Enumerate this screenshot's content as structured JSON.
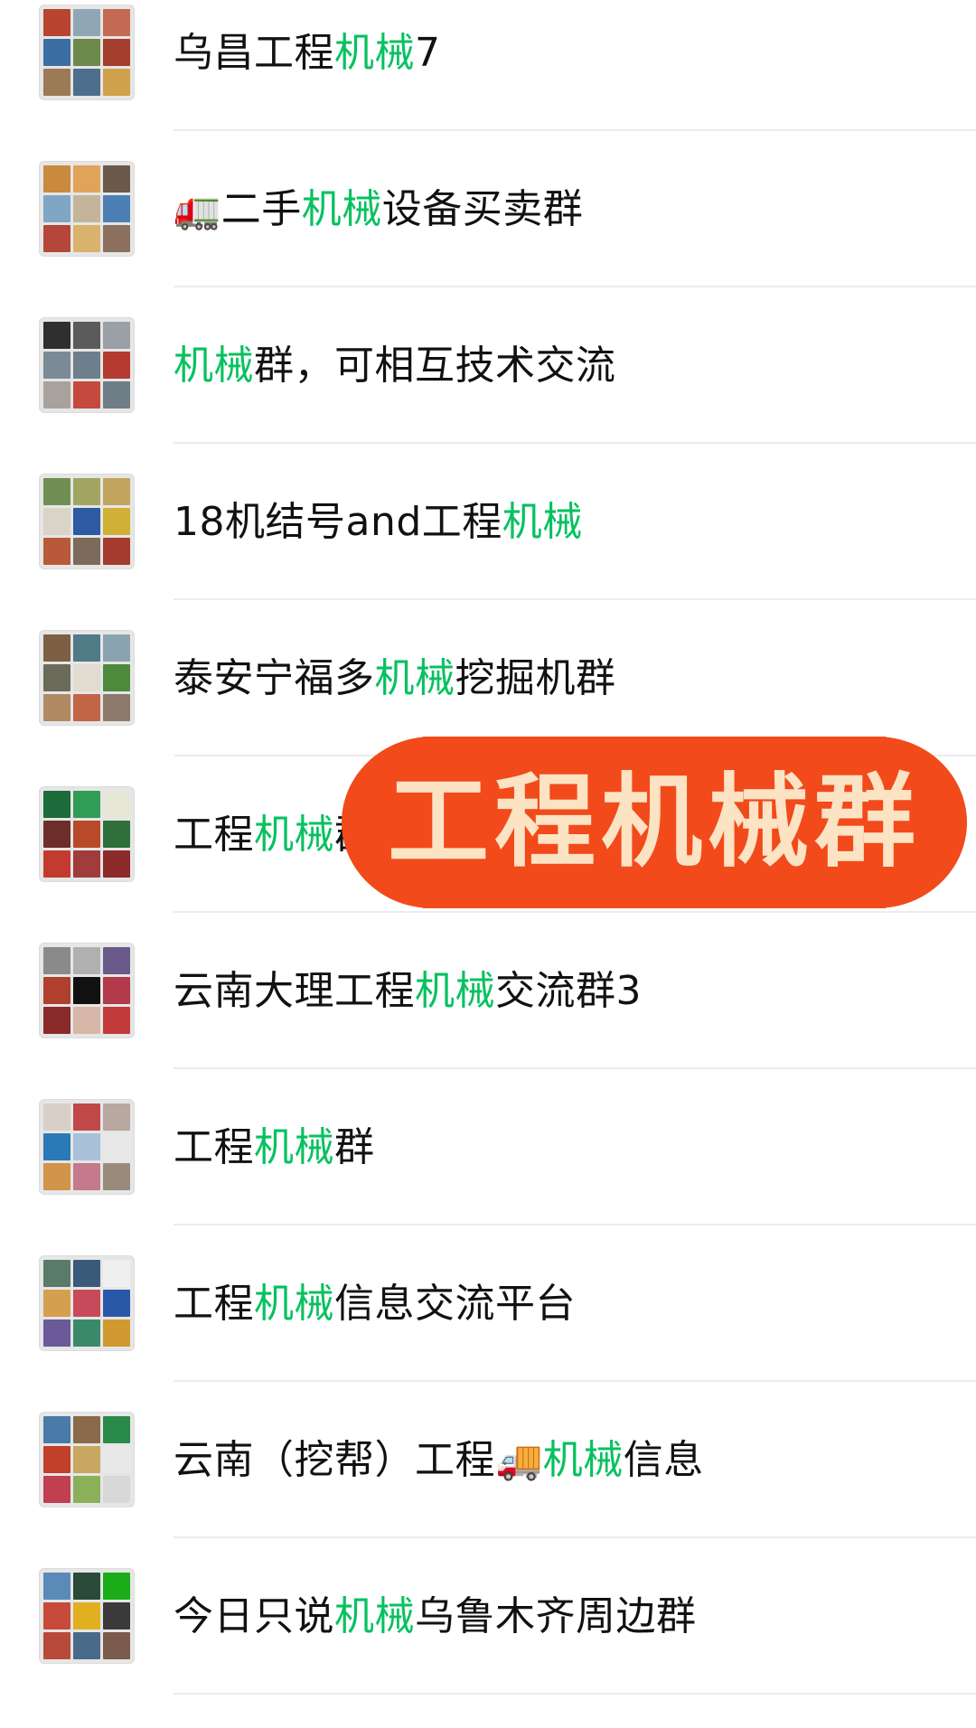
{
  "group_list": {
    "highlight_color": "#07c160",
    "items": [
      {
        "segments": [
          {
            "t": "乌昌工程"
          },
          {
            "t": "机械",
            "hl": true
          },
          {
            "t": "7"
          }
        ]
      },
      {
        "segments": [
          {
            "t": "🚛",
            "emoji": true
          },
          {
            "t": "二手"
          },
          {
            "t": "机械",
            "hl": true
          },
          {
            "t": "设备买卖群"
          }
        ]
      },
      {
        "segments": [
          {
            "t": "机械",
            "hl": true
          },
          {
            "t": "群，可相互技术交流"
          }
        ]
      },
      {
        "segments": [
          {
            "t": "18机结号and工程"
          },
          {
            "t": "机械",
            "hl": true
          }
        ]
      },
      {
        "segments": [
          {
            "t": "泰安宁福多"
          },
          {
            "t": "机械",
            "hl": true
          },
          {
            "t": "挖掘机群"
          }
        ]
      },
      {
        "segments": [
          {
            "t": "工程"
          },
          {
            "t": "机械",
            "hl": true
          },
          {
            "t": "群"
          }
        ]
      },
      {
        "segments": [
          {
            "t": "云南大理工程"
          },
          {
            "t": "机械",
            "hl": true
          },
          {
            "t": "交流群3"
          }
        ]
      },
      {
        "segments": [
          {
            "t": "工程"
          },
          {
            "t": "机械",
            "hl": true
          },
          {
            "t": "群"
          }
        ]
      },
      {
        "segments": [
          {
            "t": "工程"
          },
          {
            "t": "机械",
            "hl": true
          },
          {
            "t": "信息交流平台"
          }
        ]
      },
      {
        "segments": [
          {
            "t": "云南（挖帮）工程"
          },
          {
            "t": "🚚",
            "emoji": true
          },
          {
            "t": "机械",
            "hl": true
          },
          {
            "t": "信息"
          }
        ]
      },
      {
        "segments": [
          {
            "t": "今日只说"
          },
          {
            "t": "机械",
            "hl": true
          },
          {
            "t": "乌鲁木齐周边群"
          }
        ]
      }
    ]
  },
  "overlay_banner": {
    "text": "工程机械群",
    "bg_color": "#f24a1b",
    "text_color": "#fbe3c4"
  },
  "avatar_palettes": [
    [
      "#b8452f",
      "#8fa7b5",
      "#c46a52",
      "#3b6fa3",
      "#6c8a4a",
      "#a33d2c",
      "#9a7b55",
      "#4d6e8c",
      "#d0a24c"
    ],
    [
      "#c98a3d",
      "#e0a35a",
      "#6b5a4a",
      "#7fa6c4",
      "#c2b59b",
      "#4b7fb3",
      "#b5473a",
      "#d9b36b",
      "#8c7060"
    ],
    [
      "#2f2f2f",
      "#5b5b5b",
      "#9aa0a6",
      "#7b8a95",
      "#6d7f8c",
      "#b53a30",
      "#a7a39c",
      "#c5493c",
      "#6e7d86"
    ],
    [
      "#6f8f55",
      "#a1a562",
      "#c2a45e",
      "#d9d4c7",
      "#2d5aa0",
      "#d0b035",
      "#b85a3a",
      "#7e6a5a",
      "#a53b2f"
    ],
    [
      "#7d5f44",
      "#4f7a86",
      "#8aa3b0",
      "#6b6b5a",
      "#e1dccf",
      "#4e8a3c",
      "#b08a62",
      "#c26446",
      "#8d7a6a"
    ],
    [
      "#1d6a3a",
      "#2f9d55",
      "#e7e7d8",
      "#6b2e2a",
      "#b84a2a",
      "#2f6f3a",
      "#c23b2e",
      "#a03c3c",
      "#8c2a2a"
    ],
    [
      "#8a8a8a",
      "#b0b0b0",
      "#6a5a8a",
      "#b0402e",
      "#111111",
      "#b23a4a",
      "#8a2a2a",
      "#d7b8a8",
      "#c23a3a"
    ],
    [
      "#d8d0c8",
      "#c04848",
      "#b8a8a0",
      "#2a7ab8",
      "#a8c0d8",
      "#e8e8e8",
      "#d0944a",
      "#c47a8a",
      "#9a8a7a"
    ],
    [
      "#5a7a6a",
      "#3a5a7a",
      "#efefef",
      "#d4a050",
      "#c84a5a",
      "#2a58a8",
      "#6a5a9a",
      "#3a8a6a",
      "#d09a30"
    ],
    [
      "#4a7aa8",
      "#8a6a4a",
      "#2a8a4a",
      "#c0402a",
      "#c8a860",
      "#e8e8e8",
      "#c04050",
      "#8ab05a",
      "#d8d8d8"
    ],
    [
      "#5a8ab8",
      "#2a4a3a",
      "#1aad19",
      "#c84a3a",
      "#e0b020",
      "#3a3a3a",
      "#b84a3a",
      "#4a6a8a",
      "#7a5a4a"
    ]
  ]
}
